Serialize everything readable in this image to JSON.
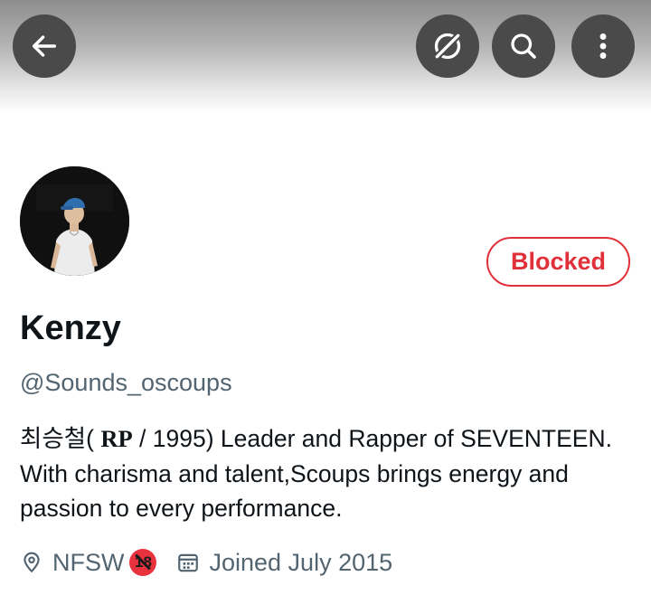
{
  "header": {
    "back_icon": "arrow-left-icon",
    "grok_icon": "grok-icon",
    "search_icon": "search-icon",
    "more_icon": "more-vertical-icon"
  },
  "profile": {
    "action_button": "Blocked",
    "name": "Kenzy",
    "handle": "@Sounds_oscoups",
    "bio": {
      "part1": "최승철( ",
      "rp": "RP",
      "part2": " / 1995) Leader and Rapper of SEVENTEEN. With charisma and talent,Scoups brings energy and passion to every performance."
    },
    "location": "NFSW",
    "location_badge": "18",
    "joined": "Joined July 2015"
  },
  "colors": {
    "blocked": "#e0303a",
    "secondary_text": "#536471",
    "button_bg": "#4a4a4a"
  }
}
